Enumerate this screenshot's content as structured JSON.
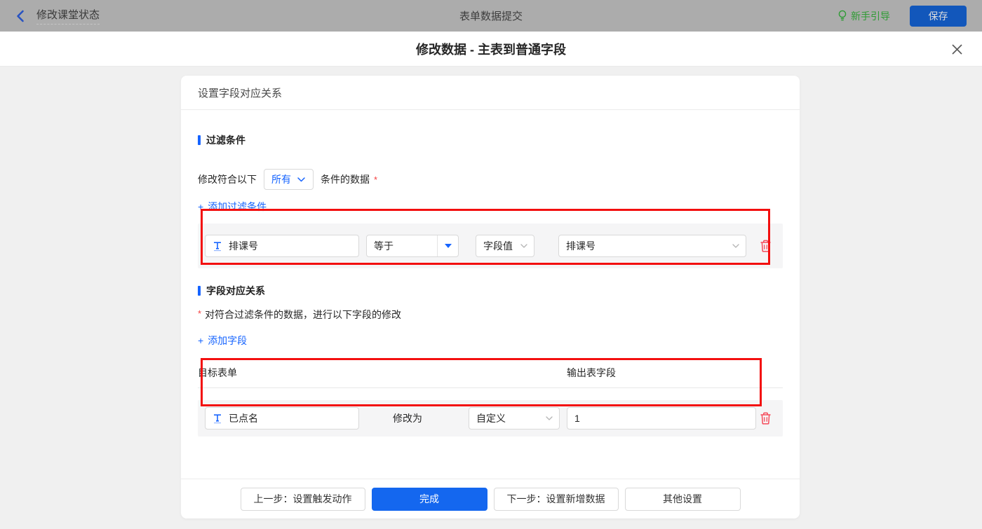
{
  "topbar": {
    "back_title": "修改课堂状态",
    "center_title": "表单数据提交",
    "guide_label": "新手引导",
    "save_label": "保存"
  },
  "dialog": {
    "title": "修改数据 - 主表到普通字段"
  },
  "card": {
    "header": "设置字段对应关系",
    "filter_section": {
      "title": "过滤条件",
      "condition_prefix": "修改符合以下",
      "condition_select_value": "所有",
      "condition_suffix": "条件的数据",
      "required_mark": "*",
      "plus": "+",
      "add_link": "添加过滤条件",
      "row": {
        "field": "排课号",
        "operator": "等于",
        "value_type": "字段值",
        "value_field": "排课号"
      }
    },
    "mapping_section": {
      "title": "字段对应关系",
      "required_mark": "*",
      "description": "对符合过滤条件的数据，进行以下字段的修改",
      "plus": "+",
      "add_link": "添加字段",
      "col_target": "目标表单",
      "col_output": "输出表字段",
      "row": {
        "field": "已点名",
        "modify_label": "修改为",
        "value_type": "自定义",
        "value": "1"
      }
    },
    "footer": {
      "prev_label": "上一步：设置触发动作",
      "done_label": "完成",
      "next_label": "下一步：设置新增数据",
      "other_label": "其他设置"
    }
  },
  "colors": {
    "accent_blue": "#1664ff",
    "annotation_red": "#f30f0f",
    "danger_red": "#f54a5a",
    "guide_green": "#2f9b35",
    "row_background": "#f5f5f6"
  }
}
